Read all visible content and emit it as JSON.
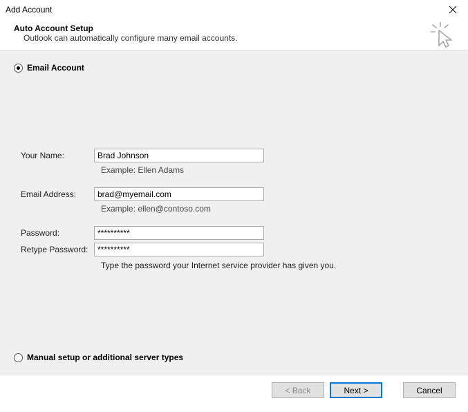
{
  "window": {
    "title": "Add Account"
  },
  "header": {
    "heading": "Auto Account Setup",
    "subheading": "Outlook can automatically configure many email accounts."
  },
  "options": {
    "email_account": "Email Account",
    "manual_setup": "Manual setup or additional server types"
  },
  "form": {
    "name_label": "Your Name:",
    "name_value": "Brad Johnson",
    "name_example": "Example: Ellen Adams",
    "email_label": "Email Address:",
    "email_value": "brad@myemail.com",
    "email_example": "Example: ellen@contoso.com",
    "password_label": "Password:",
    "password_value": "**********",
    "retype_label": "Retype Password:",
    "retype_value": "**********",
    "password_hint": "Type the password your Internet service provider has given you."
  },
  "buttons": {
    "back": "< Back",
    "next": "Next >",
    "cancel": "Cancel"
  }
}
